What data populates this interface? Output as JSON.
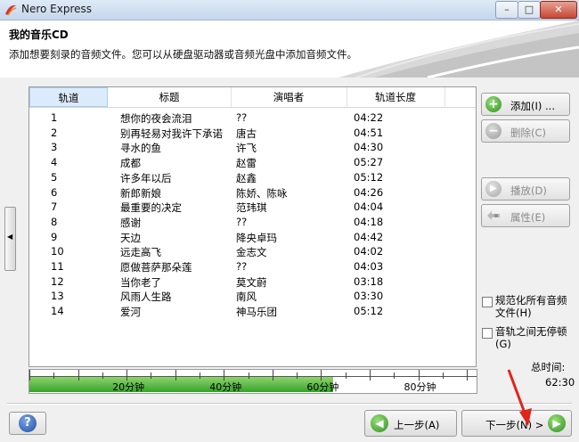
{
  "window": {
    "title": "Nero Express",
    "close_glyph": "✕",
    "minimize_glyph": "–",
    "maximize_glyph": "□"
  },
  "header": {
    "title": "我的音乐CD",
    "description": "添加想要刻录的音频文件。您可以从硬盘驱动器或音频光盘中添加音频文件。"
  },
  "columns": [
    "轨道",
    "标题",
    "演唱者",
    "轨道长度"
  ],
  "tracks": [
    {
      "num": "1",
      "title": "想你的夜会流泪",
      "artist": "??",
      "length": "04:22"
    },
    {
      "num": "2",
      "title": "别再轻易对我许下承诺",
      "artist": "唐古",
      "length": "04:51"
    },
    {
      "num": "3",
      "title": "寻水的鱼",
      "artist": "许飞",
      "length": "04:30"
    },
    {
      "num": "4",
      "title": "成都",
      "artist": "赵雷",
      "length": "05:27"
    },
    {
      "num": "5",
      "title": "许多年以后",
      "artist": "赵鑫",
      "length": "05:12"
    },
    {
      "num": "6",
      "title": "新郎新娘",
      "artist": "陈娇、陈咏",
      "length": "04:26"
    },
    {
      "num": "7",
      "title": "最重要的决定",
      "artist": "范玮琪",
      "length": "04:04"
    },
    {
      "num": "8",
      "title": "感谢",
      "artist": "??",
      "length": "04:18"
    },
    {
      "num": "9",
      "title": "天边",
      "artist": "降央卓玛",
      "length": "04:42"
    },
    {
      "num": "10",
      "title": "远走高飞",
      "artist": "金志文",
      "length": "04:02"
    },
    {
      "num": "11",
      "title": "愿做菩萨那朵莲",
      "artist": "??",
      "length": "04:03"
    },
    {
      "num": "12",
      "title": "当你老了",
      "artist": "莫文蔚",
      "length": "03:18"
    },
    {
      "num": "13",
      "title": "风雨人生路",
      "artist": "南风",
      "length": "03:30"
    },
    {
      "num": "14",
      "title": "爱河",
      "artist": "神马乐团",
      "length": "05:12"
    }
  ],
  "actions": {
    "add": "添加(I) ...",
    "delete": "删除(C)",
    "play": "播放(D)",
    "properties": "属性(E)"
  },
  "options": {
    "normalize": {
      "label_line1": "规范化所有音频",
      "label_line2": "文件(H)",
      "checked": false
    },
    "no_pause": {
      "label_line1": "音轨之间无停顿",
      "label_line2": "(G)",
      "checked": false
    }
  },
  "total": {
    "label": "总时间:",
    "value": "62:30"
  },
  "capacity": {
    "labels": [
      "20分钟",
      "40分钟",
      "60分钟",
      "80分钟"
    ],
    "used_minutes": 62.5,
    "max_minutes": 92
  },
  "nav": {
    "back": "上一步(A)",
    "next": "下一步(N) >"
  },
  "icons": {
    "app": "nero-logo-icon",
    "add": "plus-icon",
    "delete": "minus-icon",
    "play": "play-icon",
    "properties": "properties-icon",
    "help": "help-icon",
    "back": "arrow-left-icon",
    "next": "arrow-right-icon"
  },
  "colors": {
    "progress_green": "#37a32a",
    "annotation_red": "#e0251b",
    "selected_header": "#dcebfb"
  }
}
